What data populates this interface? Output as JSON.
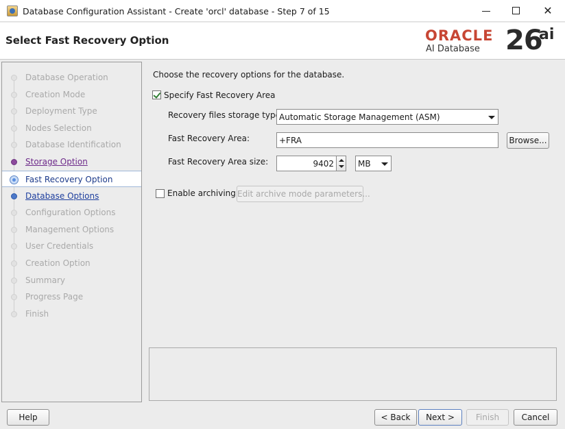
{
  "window": {
    "title": "Database Configuration Assistant - Create 'orcl' database - Step 7 of 15",
    "minimize_glyph": "",
    "close_glyph": "✕"
  },
  "header": {
    "page_title": "Select Fast Recovery Option",
    "logo": {
      "brand": "ORACLE",
      "product": "AI Database",
      "version": "26",
      "suffix": "ai",
      "brand_color": "#c74634"
    }
  },
  "nav": {
    "items": [
      {
        "label": "Database Operation",
        "state": "disabled"
      },
      {
        "label": "Creation Mode",
        "state": "disabled"
      },
      {
        "label": "Deployment Type",
        "state": "disabled"
      },
      {
        "label": "Nodes Selection",
        "state": "disabled"
      },
      {
        "label": "Database Identification",
        "state": "disabled"
      },
      {
        "label": "Storage Option",
        "state": "visited"
      },
      {
        "label": "Fast Recovery Option",
        "state": "current"
      },
      {
        "label": "Database Options",
        "state": "next"
      },
      {
        "label": "Configuration Options",
        "state": "disabled"
      },
      {
        "label": "Management Options",
        "state": "disabled"
      },
      {
        "label": "User Credentials",
        "state": "disabled"
      },
      {
        "label": "Creation Option",
        "state": "disabled"
      },
      {
        "label": "Summary",
        "state": "disabled"
      },
      {
        "label": "Progress Page",
        "state": "disabled"
      },
      {
        "label": "Finish",
        "state": "disabled"
      }
    ]
  },
  "main": {
    "intro": "Choose the recovery options for the database.",
    "specify_fra": {
      "label": "Specify Fast Recovery Area",
      "checked": true
    },
    "storage_type": {
      "label": "Recovery files storage type:",
      "value": "Automatic Storage Management (ASM)"
    },
    "fra_location": {
      "label": "Fast Recovery Area:",
      "value": "+FRA"
    },
    "browse_button": "Browse...",
    "fra_size": {
      "label": "Fast Recovery Area size:",
      "value": "9402",
      "unit": "MB"
    },
    "enable_archiving": {
      "label": "Enable archiving",
      "checked": false
    },
    "edit_archive_button": "Edit archive mode parameters..."
  },
  "footer": {
    "help": "Help",
    "back": "< Back",
    "next": "Next >",
    "finish": "Finish",
    "cancel": "Cancel"
  }
}
